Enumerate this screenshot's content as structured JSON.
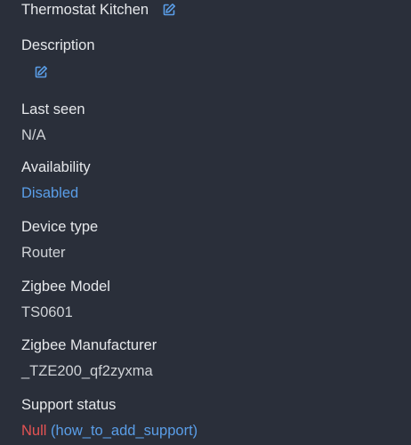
{
  "device": {
    "name": "Thermostat Kitchen",
    "edit_icon": "pencil-square-icon"
  },
  "description": {
    "label": "Description",
    "edit_icon": "pencil-square-icon"
  },
  "last_seen": {
    "label": "Last seen",
    "value": "N/A"
  },
  "availability": {
    "label": "Availability",
    "value": "Disabled"
  },
  "device_type": {
    "label": "Device type",
    "value": "Router"
  },
  "zigbee_model": {
    "label": "Zigbee Model",
    "value": "TS0601"
  },
  "zigbee_manufacturer": {
    "label": "Zigbee Manufacturer",
    "value": "_TZE200_qf2zyxma"
  },
  "support_status": {
    "label": "Support status",
    "status": "Null",
    "link": "(how_to_add_support)"
  },
  "colors": {
    "background": "#2a2f3a",
    "link": "#5a9ee8",
    "error": "#e55353"
  }
}
